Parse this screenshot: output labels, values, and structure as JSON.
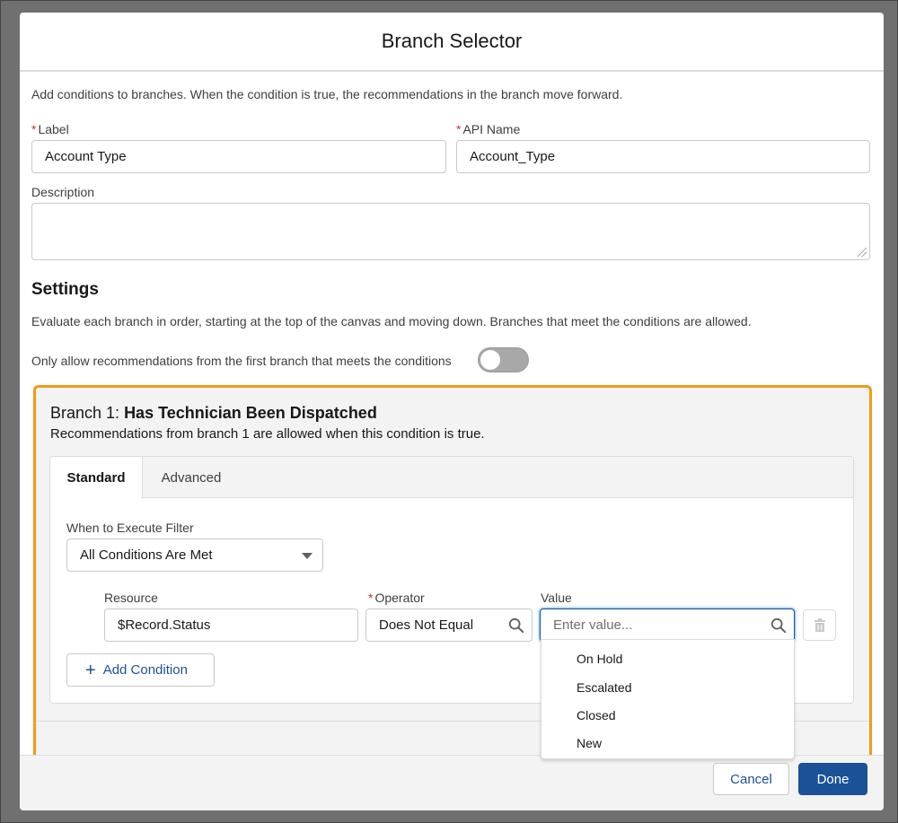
{
  "modal": {
    "title": "Branch Selector",
    "intro": "Add conditions to branches. When the condition is true, the recommendations in the branch move forward."
  },
  "fields": {
    "label_label": "Label",
    "label_value": "Account Type",
    "api_name_label": "API Name",
    "api_name_value": "Account_Type",
    "required_marker": "*",
    "description_label": "Description",
    "description_value": ""
  },
  "settings": {
    "title": "Settings",
    "description": "Evaluate each branch in order, starting at the top of the canvas and moving down. Branches that meet the conditions are allowed.",
    "toggle_label": "Only allow recommendations from the first branch that meets the conditions",
    "toggle_on": false
  },
  "branch": {
    "prefix": "Branch 1:",
    "name": "Has Technician Been Dispatched",
    "subtitle": "Recommendations from branch 1 are allowed when this condition is true.",
    "tabs": [
      {
        "label": "Standard",
        "active": true
      },
      {
        "label": "Advanced",
        "active": false
      }
    ],
    "execute_filter_label": "When to Execute Filter",
    "execute_filter_value": "All Conditions Are Met",
    "condition": {
      "resource_label": "Resource",
      "resource_value": "$Record.Status",
      "operator_label": "Operator",
      "operator_value": "Does Not Equal",
      "value_label": "Value",
      "value_placeholder": "Enter value..."
    },
    "add_condition_label": "Add Condition"
  },
  "dropdown": {
    "options": [
      "On Hold",
      "Escalated",
      "Closed",
      "New"
    ]
  },
  "footer": {
    "cancel_label": "Cancel",
    "done_label": "Done"
  },
  "colors": {
    "highlight_border": "#f39a16",
    "brand_blue": "#1b5297",
    "required_red": "#c23934"
  }
}
